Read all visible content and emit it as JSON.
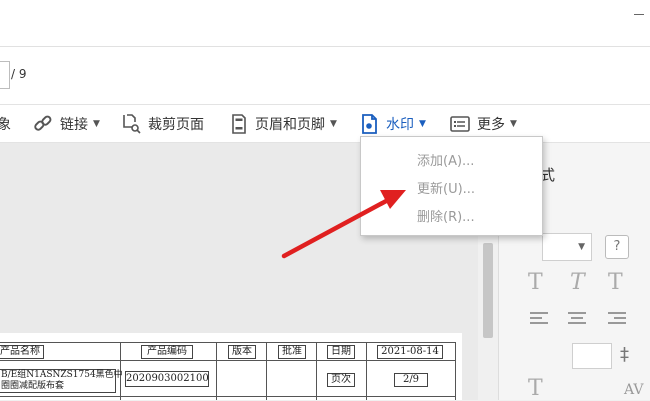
{
  "page_nav": {
    "total": "/ 9"
  },
  "toolbar": {
    "items": [
      {
        "label": "象",
        "icon": "object-icon"
      },
      {
        "label": "链接",
        "icon": "link-icon",
        "has_caret": true
      },
      {
        "label": "裁剪页面",
        "icon": "crop-page-icon"
      },
      {
        "label": "页眉和页脚",
        "icon": "header-footer-icon",
        "has_caret": true
      },
      {
        "label": "水印",
        "icon": "watermark-icon",
        "has_caret": true,
        "active": true
      },
      {
        "label": "更多",
        "icon": "more-icon",
        "has_caret": true
      }
    ],
    "caret": "▼"
  },
  "watermark_menu": {
    "items": [
      {
        "label": "添加(A)..."
      },
      {
        "label": "更新(U)..."
      },
      {
        "label": "删除(R)..."
      }
    ]
  },
  "right_panel": {
    "title": "式",
    "help": "?",
    "text_style_glyphs": [
      "T",
      "T",
      "T",
      "T"
    ],
    "av_label": "AV"
  },
  "document_table": {
    "headers": [
      "产品名称",
      "产品编码",
      "版本",
      "批准",
      "日期",
      "2021-08-14"
    ],
    "row1": {
      "name_line1": "B/E组N1ASNZS1754黑色中",
      "name_line2": "圈圈减配版布套",
      "code": "2020903002100",
      "page_label": "页次",
      "page_value": "2/9"
    }
  },
  "colors": {
    "accent": "#1b5fbf",
    "arrow": "#e02020",
    "menu_text": "#9a9a9a"
  }
}
